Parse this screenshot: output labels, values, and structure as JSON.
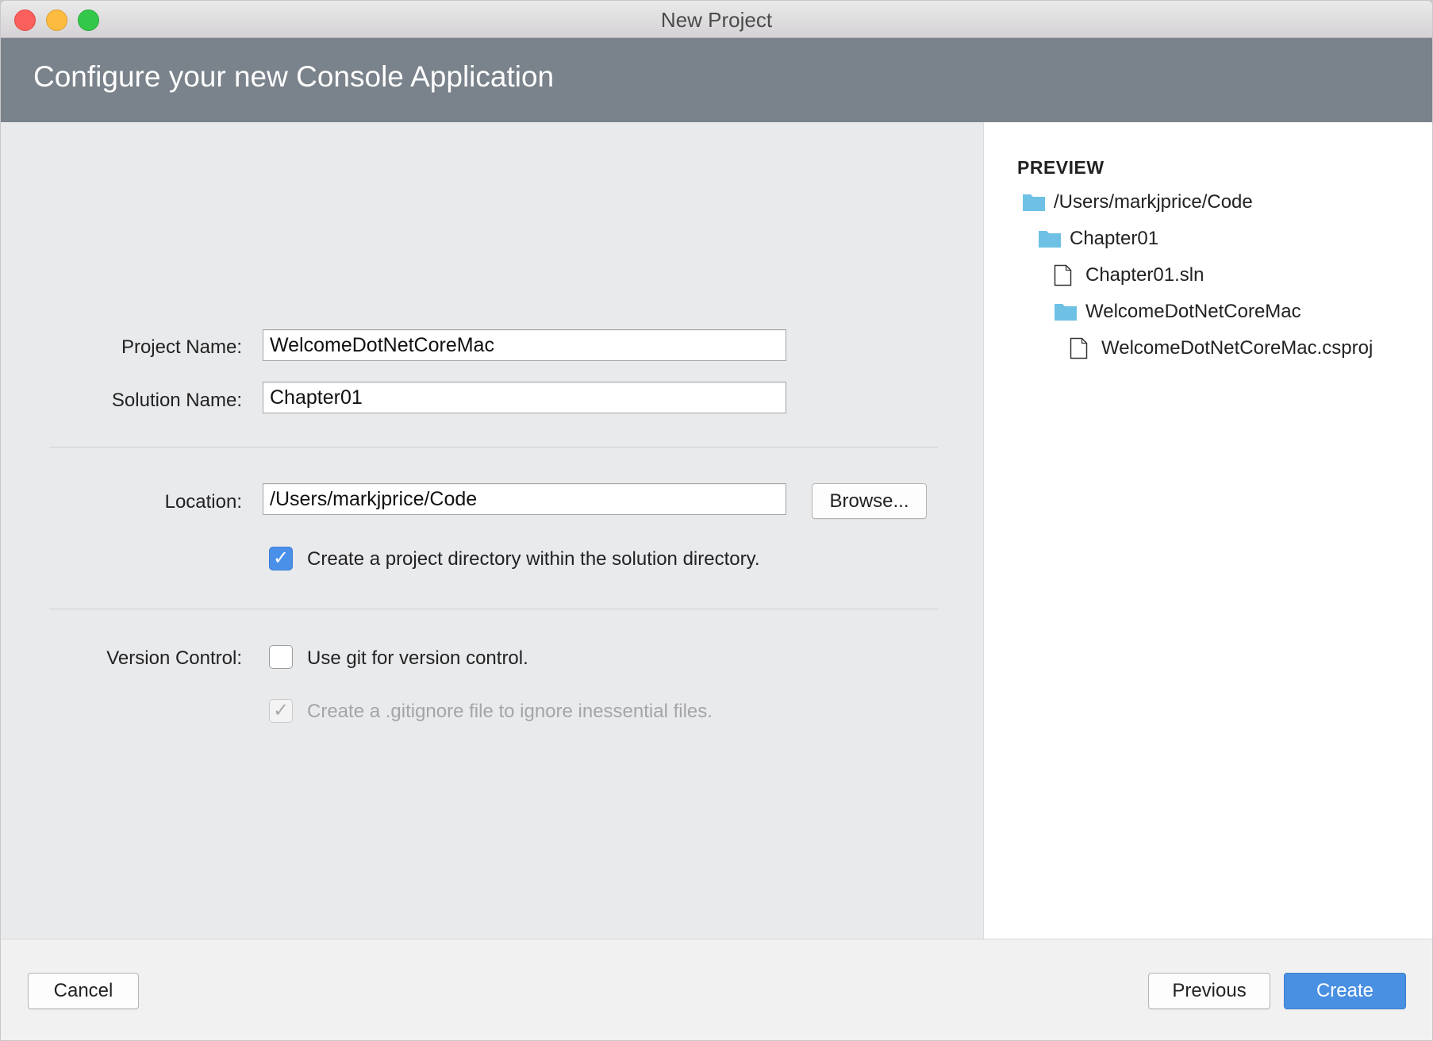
{
  "window": {
    "title": "New Project"
  },
  "header": {
    "title": "Configure your new Console Application"
  },
  "form": {
    "project_name": {
      "label": "Project Name:",
      "value": "WelcomeDotNetCoreMac"
    },
    "solution_name": {
      "label": "Solution Name:",
      "value": "Chapter01"
    },
    "location": {
      "label": "Location:",
      "value": "/Users/markjprice/Code",
      "browse_label": "Browse..."
    },
    "create_project_dir": {
      "label": "Create a project directory within the solution directory.",
      "checked": true
    },
    "version_control": {
      "label": "Version Control:",
      "use_git": {
        "label": "Use git for version control.",
        "checked": false
      },
      "gitignore": {
        "label": "Create a .gitignore file to ignore inessential files.",
        "checked": true,
        "disabled": true
      }
    }
  },
  "preview": {
    "heading": "PREVIEW",
    "tree": [
      {
        "name": "/Users/markjprice/Code",
        "type": "folder",
        "depth": 0
      },
      {
        "name": "Chapter01",
        "type": "folder",
        "depth": 1
      },
      {
        "name": "Chapter01.sln",
        "type": "file",
        "depth": 2
      },
      {
        "name": "WelcomeDotNetCoreMac",
        "type": "folder",
        "depth": 2
      },
      {
        "name": "WelcomeDotNetCoreMac.csproj",
        "type": "file",
        "depth": 3
      }
    ]
  },
  "footer": {
    "cancel_label": "Cancel",
    "previous_label": "Previous",
    "create_label": "Create"
  },
  "colors": {
    "header_bg": "#7a828b",
    "accent": "#4a90e2",
    "folder_icon": "#6ec1e4"
  }
}
